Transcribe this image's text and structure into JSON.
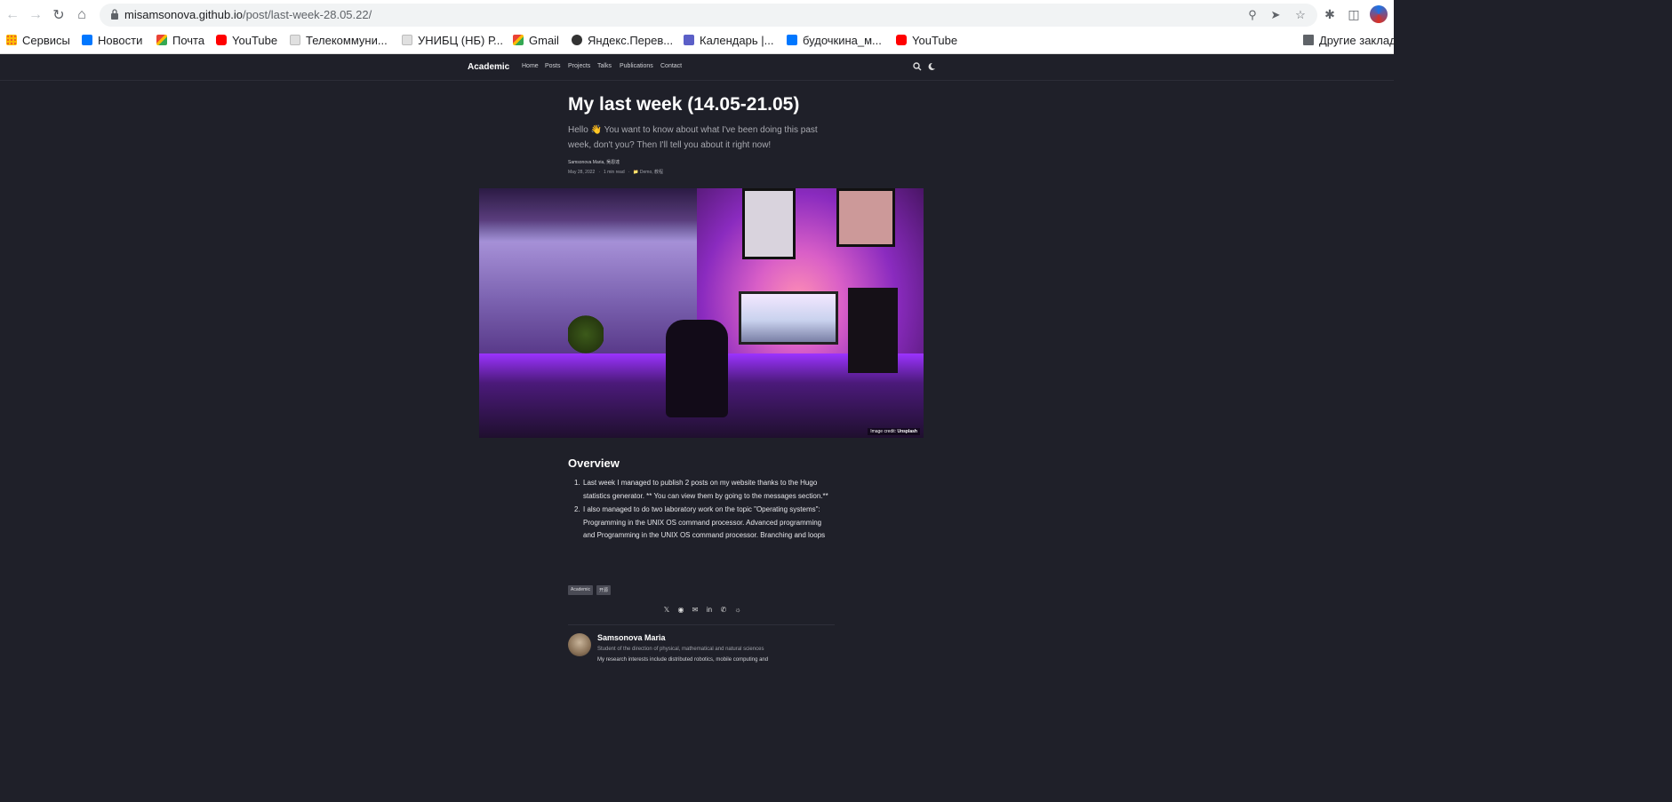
{
  "browser": {
    "url_host": "misamsonova.github.io",
    "url_path": "/post/last-week-28.05.22/",
    "bookmarks": [
      {
        "label": "Сервисы",
        "icon": "apps-grid-icon"
      },
      {
        "label": "Новости",
        "icon": "vk-icon"
      },
      {
        "label": "Почта",
        "icon": "gmail-icon"
      },
      {
        "label": "YouTube",
        "icon": "youtube-icon"
      },
      {
        "label": "Телекоммуни...",
        "icon": "site-icon"
      },
      {
        "label": "УНИБЦ (НБ) Р...",
        "icon": "site-icon"
      },
      {
        "label": "Gmail",
        "icon": "gmail-icon"
      },
      {
        "label": "Яндекс.Перев...",
        "icon": "yandex-icon"
      },
      {
        "label": "Календарь |...",
        "icon": "teams-icon"
      },
      {
        "label": "будочкина_м...",
        "icon": "vk-icon"
      },
      {
        "label": "YouTube",
        "icon": "youtube-icon"
      }
    ],
    "other_bookmarks": "Другие заклад"
  },
  "site": {
    "brand": "Academic",
    "nav": [
      "Home",
      "Posts",
      "Projects",
      "Talks",
      "Publications",
      "Contact"
    ]
  },
  "article": {
    "title": "My last week (14.05-21.05)",
    "lead": "Hello 👋 You want to know about what I've been doing this past week, don't you? Then I'll tell you about it right now!",
    "authors": "Samsonova Maria, 吳恩達",
    "date": "May 28, 2022",
    "read_time": "1 min read",
    "categories": "Demo, 教程",
    "image_credit_label": "Image credit:",
    "image_credit_source": "Unsplash",
    "overview_heading": "Overview",
    "overview_items": [
      "Last week I managed to publish 2 posts on my website thanks to the Hugo statistics generator. ** You can view them by going to the messages section.**",
      "I also managed to do two laboratory work on the topic \"Operating systems\": Programming in the UNIX OS command processor. Advanced programming and Programming in the UNIX OS command processor. Branching and loops"
    ],
    "tags": [
      "Academic",
      "开源"
    ]
  },
  "author_card": {
    "name": "Samsonova Maria",
    "role": "Student of the direction of physical, mathematical and natural sciences",
    "bio": "My research interests include distributed robotics, mobile computing and"
  }
}
